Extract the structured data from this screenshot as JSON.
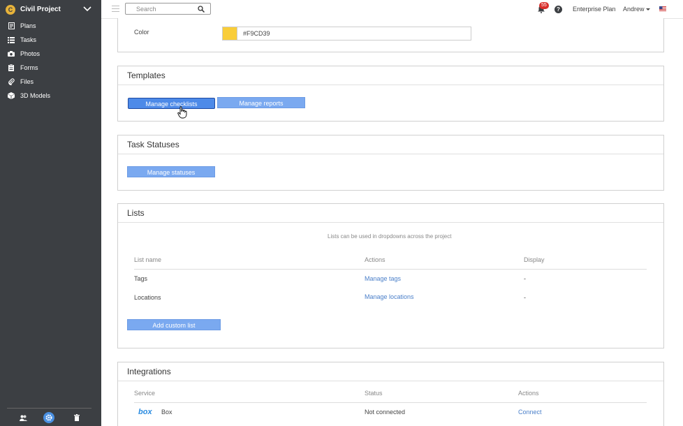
{
  "sidebar": {
    "project_name": "Civil Project",
    "items": [
      {
        "label": "Plans",
        "icon": "plans-icon"
      },
      {
        "label": "Tasks",
        "icon": "tasks-icon"
      },
      {
        "label": "Photos",
        "icon": "camera-icon"
      },
      {
        "label": "Forms",
        "icon": "forms-icon"
      },
      {
        "label": "Files",
        "icon": "paperclip-icon"
      },
      {
        "label": "3D Models",
        "icon": "cube-icon"
      }
    ],
    "footer": [
      "users-icon",
      "gear-icon",
      "trash-icon"
    ]
  },
  "topbar": {
    "search_placeholder": "Search",
    "notifications_count": "55",
    "help_label": "?",
    "plan": "Enterprise Plan",
    "user": "Andrew"
  },
  "color_section": {
    "label": "Color",
    "value": "#F9CD39"
  },
  "templates": {
    "title": "Templates",
    "manage_checklists": "Manage checklists",
    "manage_reports": "Manage reports"
  },
  "task_statuses": {
    "title": "Task Statuses",
    "manage_statuses": "Manage statuses"
  },
  "lists": {
    "title": "Lists",
    "description": "Lists can be used in dropdowns across the project",
    "headers": [
      "List name",
      "Actions",
      "Display"
    ],
    "rows": [
      {
        "name": "Tags",
        "action": "Manage tags",
        "display": "-"
      },
      {
        "name": "Locations",
        "action": "Manage locations",
        "display": "-"
      }
    ],
    "add_button": "Add custom list"
  },
  "integrations": {
    "title": "Integrations",
    "headers": [
      "Service",
      "Status",
      "Actions"
    ],
    "rows": [
      {
        "logo": "box",
        "service": "Box",
        "status": "Not connected",
        "action": "Connect"
      }
    ]
  },
  "colors": {
    "sidebar_bg": "#3c3f43",
    "button_bg": "#7aa9f0",
    "link": "#4a7fc9",
    "accent": "#F9CD39"
  }
}
